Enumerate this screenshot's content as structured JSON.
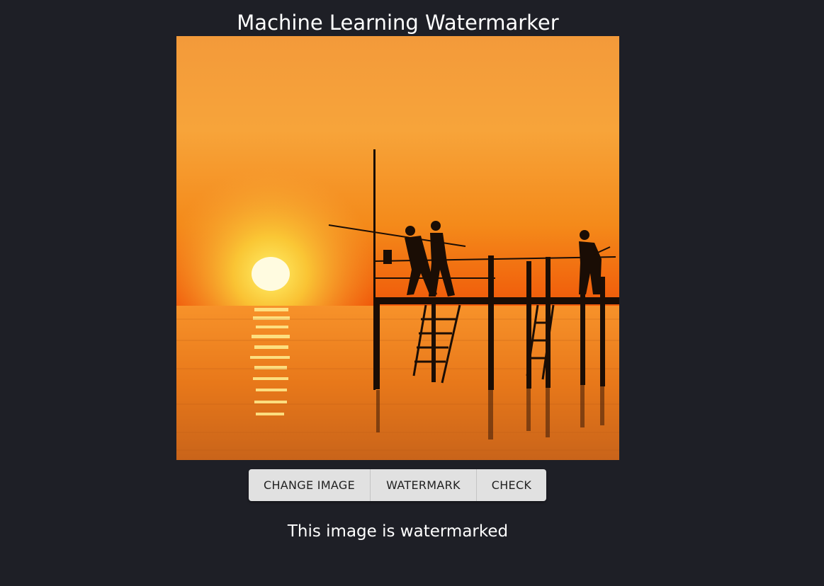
{
  "app": {
    "title": "Machine Learning Watermarker"
  },
  "image": {
    "content": "sunset-fishing-pier-photo"
  },
  "actions": {
    "change_image_label": "Change Image",
    "watermark_label": "Watermark",
    "check_label": "Check"
  },
  "status": {
    "message": "This image is watermarked"
  },
  "colors": {
    "background": "#1e1f26",
    "button_bg": "#e1e1e1",
    "text": "#ffffff"
  }
}
